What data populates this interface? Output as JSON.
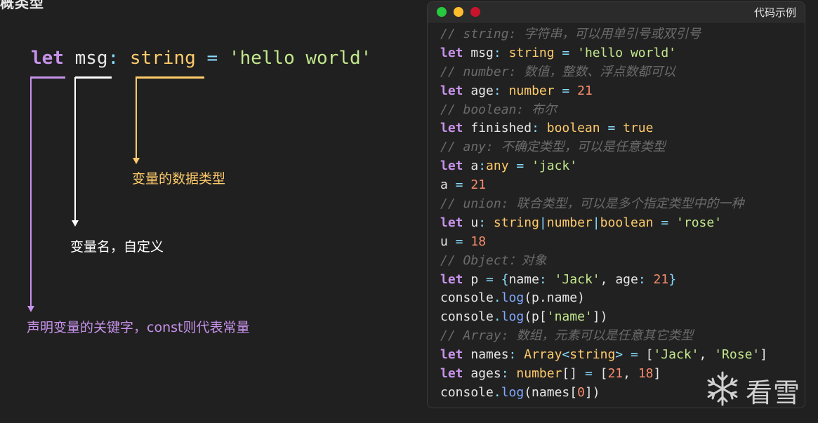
{
  "header_fragment": "概类型",
  "diagram": {
    "keyword": "let",
    "name": "msg",
    "colon": ":",
    "type": "string",
    "equals": "=",
    "value": "'hello world'",
    "label_type": "变量的数据类型",
    "label_name": "变量名，自定义",
    "label_keyword": "声明变量的关键字，const则代表常量",
    "colors": {
      "keyword": "#c792ea",
      "name": "#ffffff",
      "type": "#ffcb6b"
    }
  },
  "window": {
    "title": "代码示例",
    "buttons": {
      "close": "#27c93f",
      "minimize": "#ffbd2e",
      "zoom": "#c9142b"
    }
  },
  "code_lines": [
    [
      [
        "cmt",
        "// string: 字符串，可以用单引号或双引号"
      ]
    ],
    [
      [
        "kw",
        "let"
      ],
      [
        "plain",
        " msg"
      ],
      [
        "op",
        ": "
      ],
      [
        "typ",
        "string"
      ],
      [
        "op",
        " = "
      ],
      [
        "str",
        "'hello world'"
      ]
    ],
    [
      [
        "cmt",
        "// number: 数值，整数、浮点数都可以"
      ]
    ],
    [
      [
        "kw",
        "let"
      ],
      [
        "plain",
        " age"
      ],
      [
        "op",
        ": "
      ],
      [
        "typ",
        "number"
      ],
      [
        "op",
        " = "
      ],
      [
        "num",
        "21"
      ]
    ],
    [
      [
        "cmt",
        "// boolean: 布尔"
      ]
    ],
    [
      [
        "kw",
        "let"
      ],
      [
        "plain",
        " finished"
      ],
      [
        "op",
        ": "
      ],
      [
        "typ",
        "boolean"
      ],
      [
        "op",
        " = "
      ],
      [
        "typ",
        "true"
      ]
    ],
    [
      [
        "cmt",
        "// any: 不确定类型，可以是任意类型"
      ]
    ],
    [
      [
        "kw",
        "let"
      ],
      [
        "plain",
        " a"
      ],
      [
        "op",
        ":"
      ],
      [
        "typ",
        "any"
      ],
      [
        "op",
        " = "
      ],
      [
        "str",
        "'jack'"
      ]
    ],
    [
      [
        "plain",
        "a"
      ],
      [
        "op",
        " = "
      ],
      [
        "num",
        "21"
      ]
    ],
    [
      [
        "cmt",
        "// union: 联合类型，可以是多个指定类型中的一种"
      ]
    ],
    [
      [
        "kw",
        "let"
      ],
      [
        "plain",
        " u"
      ],
      [
        "op",
        ": "
      ],
      [
        "typ",
        "string"
      ],
      [
        "op",
        "|"
      ],
      [
        "typ",
        "number"
      ],
      [
        "op",
        "|"
      ],
      [
        "typ",
        "boolean"
      ],
      [
        "op",
        " = "
      ],
      [
        "str",
        "'rose'"
      ]
    ],
    [
      [
        "plain",
        "u"
      ],
      [
        "op",
        " = "
      ],
      [
        "num",
        "18"
      ]
    ],
    [
      [
        "cmt",
        "// Object：对象"
      ]
    ],
    [
      [
        "kw",
        "let"
      ],
      [
        "plain",
        " p"
      ],
      [
        "op",
        " = "
      ],
      [
        "brk",
        "{"
      ],
      [
        "plain",
        "name"
      ],
      [
        "op",
        ": "
      ],
      [
        "str",
        "'Jack'"
      ],
      [
        "plain",
        ", age"
      ],
      [
        "op",
        ": "
      ],
      [
        "num",
        "21"
      ],
      [
        "brk",
        "}"
      ]
    ],
    [
      [
        "plain",
        "console"
      ],
      [
        "op",
        "."
      ],
      [
        "fn",
        "log"
      ],
      [
        "plain",
        "(p.name)"
      ]
    ],
    [
      [
        "plain",
        "console"
      ],
      [
        "op",
        "."
      ],
      [
        "fn",
        "log"
      ],
      [
        "plain",
        "(p["
      ],
      [
        "str",
        "'name'"
      ],
      [
        "plain",
        "])"
      ]
    ],
    [
      [
        "cmt",
        "// Array: 数组，元素可以是任意其它类型"
      ]
    ],
    [
      [
        "kw",
        "let"
      ],
      [
        "plain",
        " names"
      ],
      [
        "op",
        ": "
      ],
      [
        "typ",
        "Array"
      ],
      [
        "op",
        "<"
      ],
      [
        "typ",
        "string"
      ],
      [
        "op",
        "> = "
      ],
      [
        "plain",
        "["
      ],
      [
        "str",
        "'Jack'"
      ],
      [
        "plain",
        ", "
      ],
      [
        "str",
        "'Rose'"
      ],
      [
        "plain",
        "]"
      ]
    ],
    [
      [
        "kw",
        "let"
      ],
      [
        "plain",
        " ages"
      ],
      [
        "op",
        ": "
      ],
      [
        "typ",
        "number"
      ],
      [
        "plain",
        "[]"
      ],
      [
        "op",
        " = "
      ],
      [
        "plain",
        "["
      ],
      [
        "num",
        "21"
      ],
      [
        "plain",
        ", "
      ],
      [
        "num",
        "18"
      ],
      [
        "plain",
        "]"
      ]
    ],
    [
      [
        "plain",
        "console"
      ],
      [
        "op",
        "."
      ],
      [
        "fn",
        "log"
      ],
      [
        "plain",
        "(names["
      ],
      [
        "num",
        "0"
      ],
      [
        "plain",
        "])"
      ]
    ]
  ],
  "watermark": {
    "text": "看雪",
    "icon": "snowflake-icon"
  }
}
